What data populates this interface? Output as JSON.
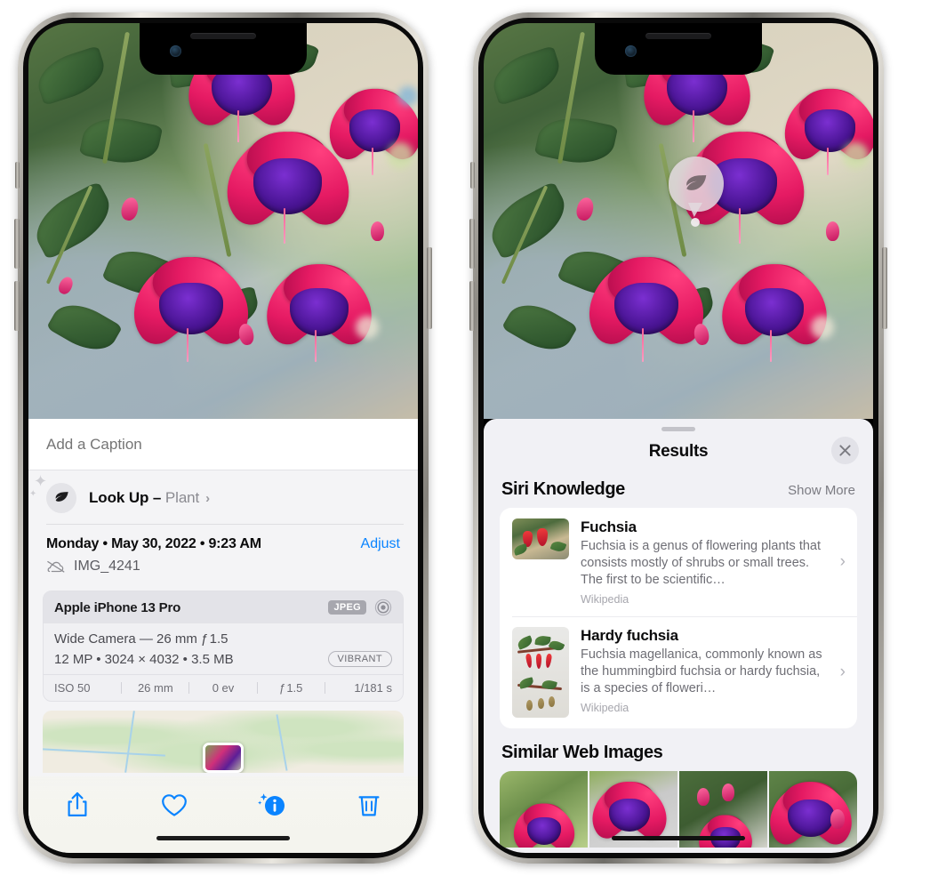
{
  "left_phone": {
    "name": "iphone-photos-info",
    "caption": {
      "placeholder": "Add a Caption",
      "value": ""
    },
    "lookup": {
      "icon": "leaf-icon",
      "label": "Look Up – ",
      "subject": "Plant",
      "chevron": "›"
    },
    "metadata": {
      "date": "Monday • May 30, 2022 • 9:23 AM",
      "adjust_label": "Adjust",
      "cloud_icon": "cloud-slash-icon",
      "filename": "IMG_4241"
    },
    "camera": {
      "model": "Apple iPhone 13 Pro",
      "format_badge": "JPEG",
      "lens_icon": "lens-aperture-icon",
      "lens_line": "Wide Camera — 26 mm ƒ 1.5",
      "spec_line": "12 MP • 3024 × 4032 • 3.5 MB",
      "quality_badge": "VIBRANT",
      "exif": [
        "ISO 50",
        "26 mm",
        "0 ev",
        "ƒ 1.5",
        "1/181 s"
      ]
    },
    "toolbar": [
      {
        "name": "share-icon",
        "label": "Share"
      },
      {
        "name": "heart-icon",
        "label": "Favorite"
      },
      {
        "name": "info-sparkle-icon",
        "label": "Info"
      },
      {
        "name": "trash-icon",
        "label": "Delete"
      }
    ]
  },
  "right_phone": {
    "name": "iphone-visual-lookup-results",
    "ai_badge": {
      "icon": "leaf-icon",
      "label": "Visual Look Up"
    },
    "sheet": {
      "grabber": "drag-handle",
      "title": "Results",
      "close_icon": "close-icon"
    },
    "siri_knowledge": {
      "title": "Siri Knowledge",
      "action": "Show More",
      "items": [
        {
          "title": "Fuchsia",
          "description": "Fuchsia is a genus of flowering plants that consists mostly of shrubs or small trees. The first to be scientific…",
          "source": "Wikipedia",
          "chevron": "›"
        },
        {
          "title": "Hardy fuchsia",
          "description": "Fuchsia magellanica, commonly known as the hummingbird fuchsia or hardy fuchsia, is a species of floweri…",
          "source": "Wikipedia",
          "chevron": "›"
        }
      ]
    },
    "similar_web_images": {
      "title": "Similar Web Images",
      "count": 4
    }
  },
  "colors": {
    "accent_blue": "#0a84ff",
    "sheet_bg": "#f1f1f5",
    "card_bg": "#ffffff",
    "secondary_text": "#6e6e75",
    "tertiary_text": "#a6a6ad"
  }
}
